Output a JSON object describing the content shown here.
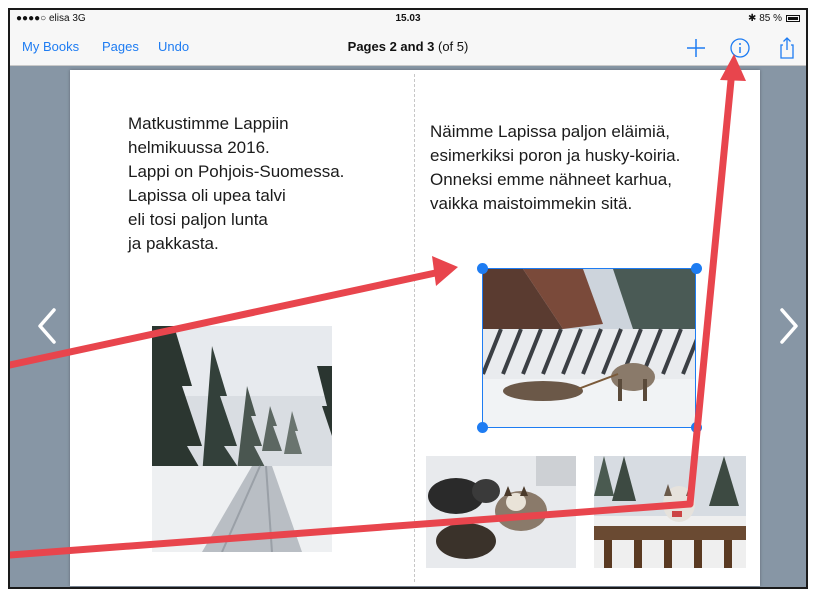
{
  "status": {
    "carrier": "●●●●○ elisa  3G",
    "time": "15.03",
    "battery": "✱ 85 %"
  },
  "nav": {
    "my_books": "My Books",
    "pages": "Pages",
    "undo": "Undo",
    "title_bold": "Pages 2 and 3",
    "title_rest": " (of 5)"
  },
  "left_page": {
    "text": "Matkustimme Lappiin\nhelmikuussa 2016.\nLappi on Pohjois-Suomessa.\nLapissa oli upea talvi\neli tosi paljon lunta\nja pakkasta."
  },
  "right_page": {
    "text": "Näimme Lapissa paljon eläimiä,\nesimerkiksi poron ja husky-koiria.\nOnneksi emme nähneet karhua,\nvaikka maistoimmekin sitä."
  },
  "colors": {
    "accent": "#1e7cf2",
    "annotation_arrow": "#e8454d"
  }
}
